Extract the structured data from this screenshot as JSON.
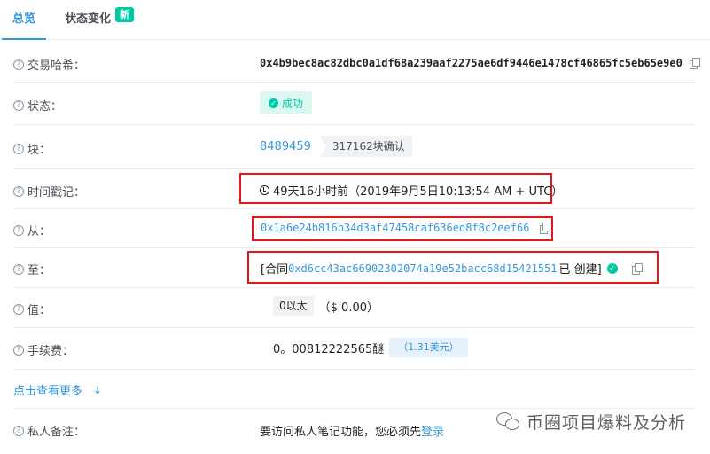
{
  "tabs": {
    "overview": "总览",
    "state_changes": "状态变化",
    "new_badge": "新"
  },
  "rows": {
    "tx_hash": {
      "label": "交易哈希：",
      "value": "0x4b9bec8ac82dbc0a1df68a239aaf2275ae6df9446e1478cf46865fc5eb65e9e0"
    },
    "status": {
      "label": "状态：",
      "value": "成功"
    },
    "block": {
      "label": "块：",
      "number": "8489459",
      "confirmations": "317162块确认"
    },
    "timestamp": {
      "label": "时间戳记：",
      "value": "49天16小时前（2019年9月5日10:13:54 AM + UTC）"
    },
    "from": {
      "label": "从：",
      "address": "0x1a6e24b816b34d3af47458caf636ed8f8c2eef66"
    },
    "to": {
      "label": "至：",
      "prefix": "[合同",
      "address": "0xd6cc43ac66902302074a19e52bacc68d15421551",
      "created": "已 创建]"
    },
    "value": {
      "label": "值：",
      "amount": "0以太",
      "usd": "（$ 0.00）"
    },
    "fee": {
      "label": "手续费：",
      "amount": "0。00812222565醚",
      "usd": "（1.31美元）"
    },
    "note": {
      "label": "私人备注：",
      "text": "要访问私人笔记功能，您必须先",
      "login": "登录"
    }
  },
  "more": {
    "label": "点击查看更多"
  },
  "watermark": {
    "text": "币圈项目爆料及分析"
  },
  "colors": {
    "link": "#3498db",
    "success": "#00c9a7",
    "highlight_box": "#e4161b"
  },
  "icons": [
    "help-icon",
    "copy-icon",
    "check-circle-icon",
    "clock-icon",
    "arrow-down-icon",
    "wechat-icon"
  ]
}
